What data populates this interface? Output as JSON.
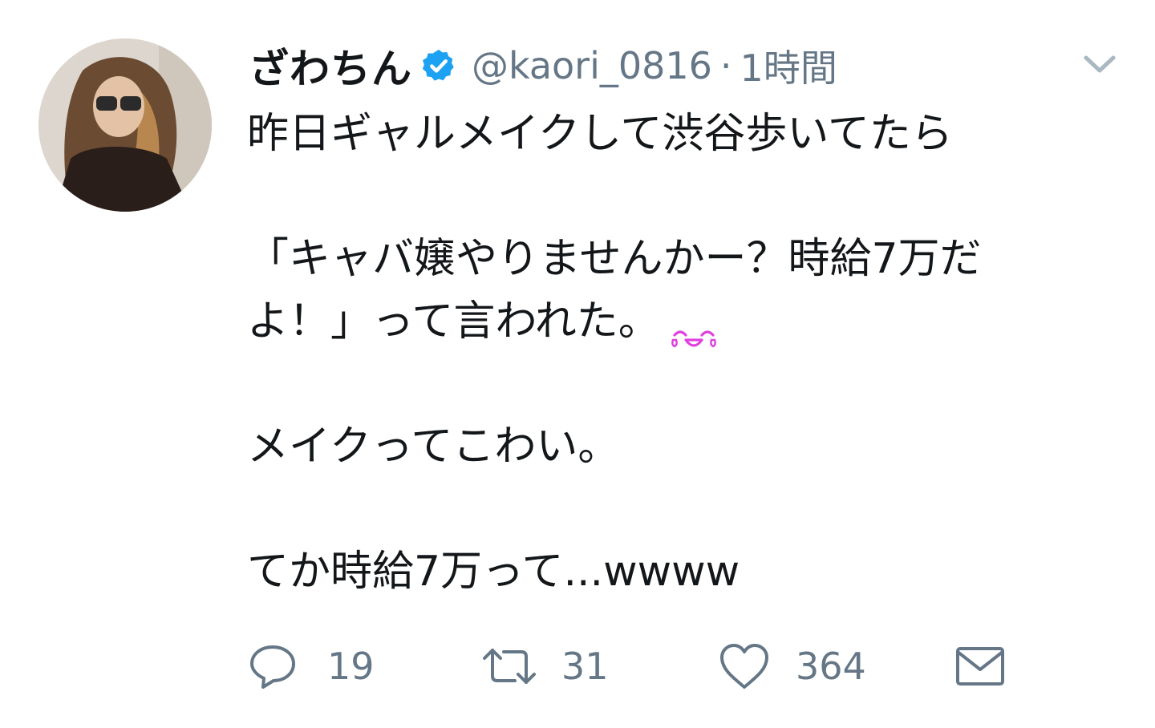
{
  "tweet": {
    "author": {
      "name": "ざわちん",
      "handle": "@kaori_0816",
      "verified": true,
      "avatar_icon": "profile-photo"
    },
    "separator": "·",
    "time": "1時間",
    "lines": [
      "昨日ギャルメイクして渋谷歩いてたら",
      "",
      "「キャバ嬢やりませんかー？時給7万だ",
      "よ！」って言われた。",
      "",
      "メイクってこわい。",
      "",
      "てか時給7万って...wwww"
    ],
    "emoji": "laughing-face-emoji",
    "actions": {
      "reply_count": "19",
      "retweet_count": "31",
      "like_count": "364"
    }
  },
  "colors": {
    "text": "#14171a",
    "secondary": "#657786",
    "verified": "#1da1f2",
    "emoji": "#e040e0"
  }
}
